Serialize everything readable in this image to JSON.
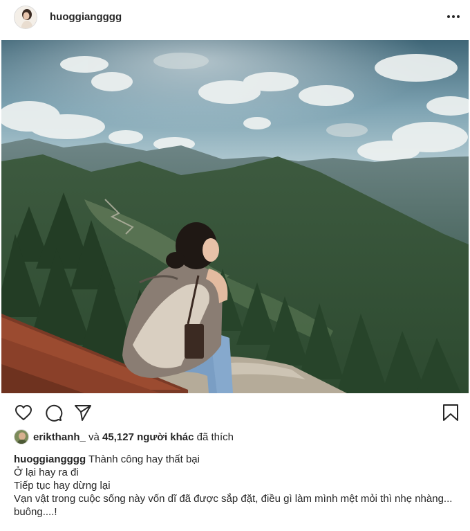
{
  "post": {
    "username": "huoggiangggg",
    "more_icon": "ellipsis-icon",
    "actions": {
      "like_icon": "heart-icon",
      "comment_icon": "comment-icon",
      "share_icon": "paper-plane-icon",
      "save_icon": "bookmark-icon"
    },
    "likes": {
      "liker": "erikthanh_",
      "connector": " và ",
      "count_text": "45,127 người khác",
      "suffix": " đã thích"
    },
    "caption": {
      "author": "huoggiangggg",
      "first_line": " Thành công hay thất bại",
      "lines": [
        "Ở lại hay ra đi",
        "Tiếp tục hay dừng lại",
        "Vạn vật trong cuộc sống này vốn dĩ đã được sắp đặt, điều gì làm mình mệt mỏi thì nhẹ nhàng...",
        "buông....!"
      ]
    }
  }
}
